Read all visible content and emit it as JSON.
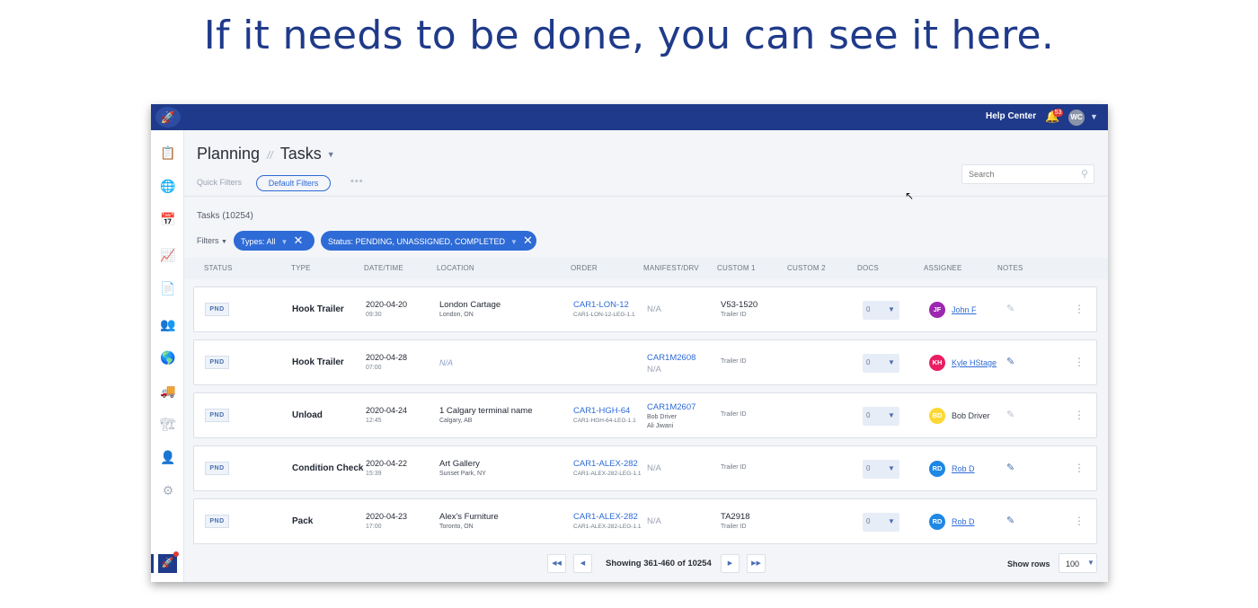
{
  "headline": "If it needs to be done, you can see it here.",
  "topbar": {
    "help_label": "Help Center",
    "notification_count": "53",
    "user_initials": "WC"
  },
  "page": {
    "section": "Planning",
    "title": "Tasks",
    "quick_filters_label": "Quick Filters",
    "default_filters_label": "Default Filters",
    "search_placeholder": "Search",
    "task_count_label": "Tasks (10254)",
    "filters_label": "Filters",
    "filter_chips": [
      "Types: All",
      "Status: PENDING, UNASSIGNED, COMPLETED"
    ]
  },
  "table": {
    "columns": [
      "STATUS",
      "TYPE",
      "DATE/TIME",
      "LOCATION",
      "ORDER",
      "MANIFEST/DRV",
      "CUSTOM 1",
      "CUSTOM 2",
      "DOCS",
      "ASSIGNEE",
      "NOTES"
    ],
    "rows": [
      {
        "status": "PND",
        "type": "Hook Trailer",
        "date": "2020-04-20",
        "time": "09:30",
        "location": "London Cartage",
        "location_sub": "London, ON",
        "order": "CAR1-LON-12",
        "order_sub": "CAR1-LON-12-LEG-1.1",
        "manifest": "",
        "manifest_na": "N/A",
        "manifest_sub": "",
        "manifest_sub2": "",
        "custom1": "V53-1520",
        "custom1_sub": "Trailer ID",
        "docs": "0",
        "assignee_initials": "JF",
        "assignee": "John F",
        "assignee_color": "#9c27b0",
        "assignee_link": true,
        "note_color": "#b9c0cc"
      },
      {
        "status": "PND",
        "type": "Hook Trailer",
        "date": "2020-04-28",
        "time": "07:00",
        "location": "N/A",
        "location_sub": "",
        "order": "",
        "order_sub": "",
        "manifest": "CAR1M2608",
        "manifest_na": "N/A",
        "manifest_sub": "",
        "manifest_sub2": "",
        "custom1": "",
        "custom1_sub": "Trailer ID",
        "docs": "0",
        "assignee_initials": "KH",
        "assignee": "Kyle HStage",
        "assignee_color": "#e91e63",
        "assignee_link": true,
        "note_color": "#4a6fb0"
      },
      {
        "status": "PND",
        "type": "Unload",
        "date": "2020-04-24",
        "time": "12:45",
        "location": "1 Calgary terminal name",
        "location_sub": "Calgary, AB",
        "order": "CAR1-HGH-64",
        "order_sub": "CAR1-HGH-64-LEG-1.1",
        "manifest": "CAR1M2607",
        "manifest_na": "",
        "manifest_sub": "Bob Driver",
        "manifest_sub2": "Ali Jiwani",
        "custom1": "",
        "custom1_sub": "Trailer ID",
        "docs": "0",
        "assignee_initials": "BD",
        "assignee": "Bob Driver",
        "assignee_color": "#fdd835",
        "assignee_link": false,
        "note_color": "#b9c0cc"
      },
      {
        "status": "PND",
        "type": "Condition Check",
        "date": "2020-04-22",
        "time": "15:39",
        "location": "Art Gallery",
        "location_sub": "Sunset Park, NY",
        "order": "CAR1-ALEX-282",
        "order_sub": "CAR1-ALEX-282-LEG-1.1",
        "manifest": "",
        "manifest_na": "N/A",
        "manifest_sub": "",
        "manifest_sub2": "",
        "custom1": "",
        "custom1_sub": "Trailer ID",
        "docs": "0",
        "assignee_initials": "RD",
        "assignee": "Rob D",
        "assignee_color": "#1e88e5",
        "assignee_link": true,
        "note_color": "#4a6fb0"
      },
      {
        "status": "PND",
        "type": "Pack",
        "date": "2020-04-23",
        "time": "17:00",
        "location": "Alex's Furniture",
        "location_sub": "Toronto, ON",
        "order": "CAR1-ALEX-282",
        "order_sub": "CAR1-ALEX-282-LEG-1.1",
        "manifest": "",
        "manifest_na": "N/A",
        "manifest_sub": "",
        "manifest_sub2": "",
        "custom1": "TA2918",
        "custom1_sub": "Trailer ID",
        "docs": "0",
        "assignee_initials": "RD",
        "assignee": "Rob D",
        "assignee_color": "#1e88e5",
        "assignee_link": true,
        "note_color": "#4a6fb0"
      }
    ]
  },
  "pagination": {
    "showing": "Showing 361-460 of 10254",
    "show_rows_label": "Show rows",
    "rows_per_page": "100"
  },
  "icons": {
    "sidebar": [
      "clipboard-icon",
      "globe-icon",
      "calendar-icon",
      "chart-icon",
      "invoice-icon",
      "people-icon",
      "globe-dollar-icon",
      "truck-icon",
      "forklift-icon",
      "user-circle-icon",
      "gear-icon"
    ]
  }
}
